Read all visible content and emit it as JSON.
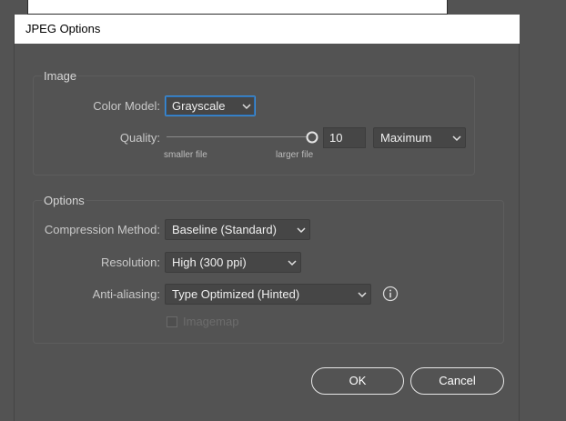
{
  "dialog": {
    "title": "JPEG Options"
  },
  "image_group": {
    "label": "Image",
    "color_model_label": "Color Model:",
    "color_model_value": "Grayscale",
    "quality_label": "Quality:",
    "quality_value": "10",
    "quality_level": 1.0,
    "quality_preset": "Maximum",
    "smaller_file": "smaller file",
    "larger_file": "larger file"
  },
  "options_group": {
    "label": "Options",
    "compression_label": "Compression Method:",
    "compression_value": "Baseline (Standard)",
    "resolution_label": "Resolution:",
    "resolution_value": "High (300 ppi)",
    "antialias_label": "Anti-aliasing:",
    "antialias_value": "Type Optimized (Hinted)",
    "imagemap_label": "Imagemap",
    "imagemap_checked": false
  },
  "buttons": {
    "ok": "OK",
    "cancel": "Cancel"
  },
  "colors": {
    "background": "#535353",
    "focus_ring": "#3f8fd8",
    "title_bar": "#ffffff"
  },
  "icons": [
    "chevron-down-icon",
    "info-icon",
    "slider-knob-icon"
  ]
}
